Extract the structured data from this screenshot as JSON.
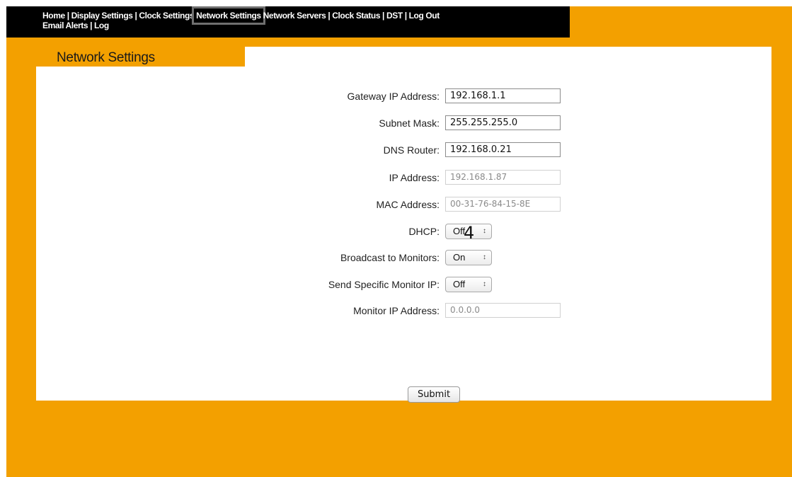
{
  "nav": {
    "line1": [
      {
        "label": "Home",
        "active": false
      },
      {
        "label": "Display Settings",
        "active": false
      },
      {
        "label": "Clock Settings",
        "active": false
      },
      {
        "label": "Network Settings",
        "active": true
      },
      {
        "label": "Network Servers",
        "active": false
      },
      {
        "label": "Clock Status",
        "active": false
      },
      {
        "label": "DST",
        "active": false
      },
      {
        "label": "Log Out",
        "active": false
      }
    ],
    "line2": [
      {
        "label": "Email Alerts"
      },
      {
        "label": "Log"
      }
    ],
    "separator": "|"
  },
  "panel": {
    "title": "Network Settings"
  },
  "form": {
    "gateway": {
      "label": "Gateway IP Address:",
      "value": "192.168.1.1"
    },
    "subnet": {
      "label": "Subnet Mask:",
      "value": "255.255.255.0"
    },
    "dns": {
      "label": "DNS Router:",
      "value": "192.168.0.21"
    },
    "ip": {
      "label": "IP Address:",
      "value": "192.168.1.87"
    },
    "mac": {
      "label": "MAC Address:",
      "value": "00-31-76-84-15-8E"
    },
    "dhcp": {
      "label": "DHCP:",
      "value": "Off"
    },
    "broadcast": {
      "label": "Broadcast to Monitors:",
      "value": "On"
    },
    "send_specific": {
      "label": "Send Specific Monitor IP:",
      "value": "Off"
    },
    "monitor_ip": {
      "label": "Monitor IP Address:",
      "value": "0.0.0.0"
    },
    "submit_label": "Submit"
  },
  "annotation": "4",
  "colors": {
    "background": "#F3A000",
    "nav_bg": "#000000",
    "panel_bg": "#FFFFFF",
    "active_outline": "#6F6F6F"
  }
}
